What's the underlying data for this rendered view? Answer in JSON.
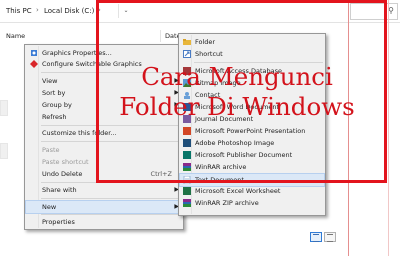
{
  "breadcrumb": {
    "items": [
      "This PC",
      "Local Disk (C:)"
    ],
    "separator": "›",
    "dropdown_glyph": "⌄"
  },
  "columns": {
    "name": "Name",
    "date": "Date"
  },
  "context_menu": {
    "items": [
      {
        "label": "Graphics Properties...",
        "icon": "intel-graphics-icon"
      },
      {
        "label": "Configure Switchable Graphics",
        "icon": "amd-graphics-icon"
      },
      {
        "label": "View",
        "submenu": true
      },
      {
        "label": "Sort by",
        "submenu": true
      },
      {
        "label": "Group by",
        "submenu": true
      },
      {
        "label": "Refresh"
      },
      {
        "label": "Customize this folder..."
      },
      {
        "label": "Paste",
        "disabled": true
      },
      {
        "label": "Paste shortcut",
        "disabled": true
      },
      {
        "label": "Undo Delete",
        "shortcut": "Ctrl+Z"
      },
      {
        "label": "Share with",
        "submenu": true
      },
      {
        "label": "New",
        "submenu": true,
        "highlighted": true
      },
      {
        "label": "Properties"
      }
    ],
    "arrow_glyph": "▶"
  },
  "new_submenu": {
    "items": [
      {
        "label": "Folder",
        "icon": "folder-icon",
        "color": "#e8b63a"
      },
      {
        "label": "Shortcut",
        "icon": "shortcut-icon",
        "color": "#4a7cc4"
      },
      {
        "label": "Microsoft Access Database",
        "icon": "access-icon",
        "color": "#a4373a"
      },
      {
        "label": "Bitmap image",
        "icon": "bitmap-icon",
        "color": "#5a9bd4"
      },
      {
        "label": "Contact",
        "icon": "contact-icon",
        "color": "#6aa0d8"
      },
      {
        "label": "Microsoft Word Document",
        "icon": "word-icon",
        "color": "#2b5797"
      },
      {
        "label": "Journal Document",
        "icon": "journal-icon",
        "color": "#7a5aa0"
      },
      {
        "label": "Microsoft PowerPoint Presentation",
        "icon": "powerpoint-icon",
        "color": "#d24726"
      },
      {
        "label": "Adobe Photoshop Image",
        "icon": "photoshop-icon",
        "color": "#1f4e79"
      },
      {
        "label": "Microsoft Publisher Document",
        "icon": "publisher-icon",
        "color": "#077568"
      },
      {
        "label": "WinRAR archive",
        "icon": "winrar-icon",
        "color": "#8a2a8a"
      },
      {
        "label": "Text Document",
        "icon": "text-document-icon",
        "color": "#9bb7d4",
        "highlighted": true
      },
      {
        "label": "Microsoft Excel Worksheet",
        "icon": "excel-icon",
        "color": "#1e7145"
      },
      {
        "label": "WinRAR ZIP archive",
        "icon": "winrar-zip-icon",
        "color": "#8a2a8a"
      }
    ]
  },
  "overlay": {
    "title_line1": "Cara Mengunci",
    "title_line2": "Folder Di Windows",
    "color": "#d3121b"
  },
  "search": {
    "icon": "search-icon",
    "glyph": "⚲"
  }
}
